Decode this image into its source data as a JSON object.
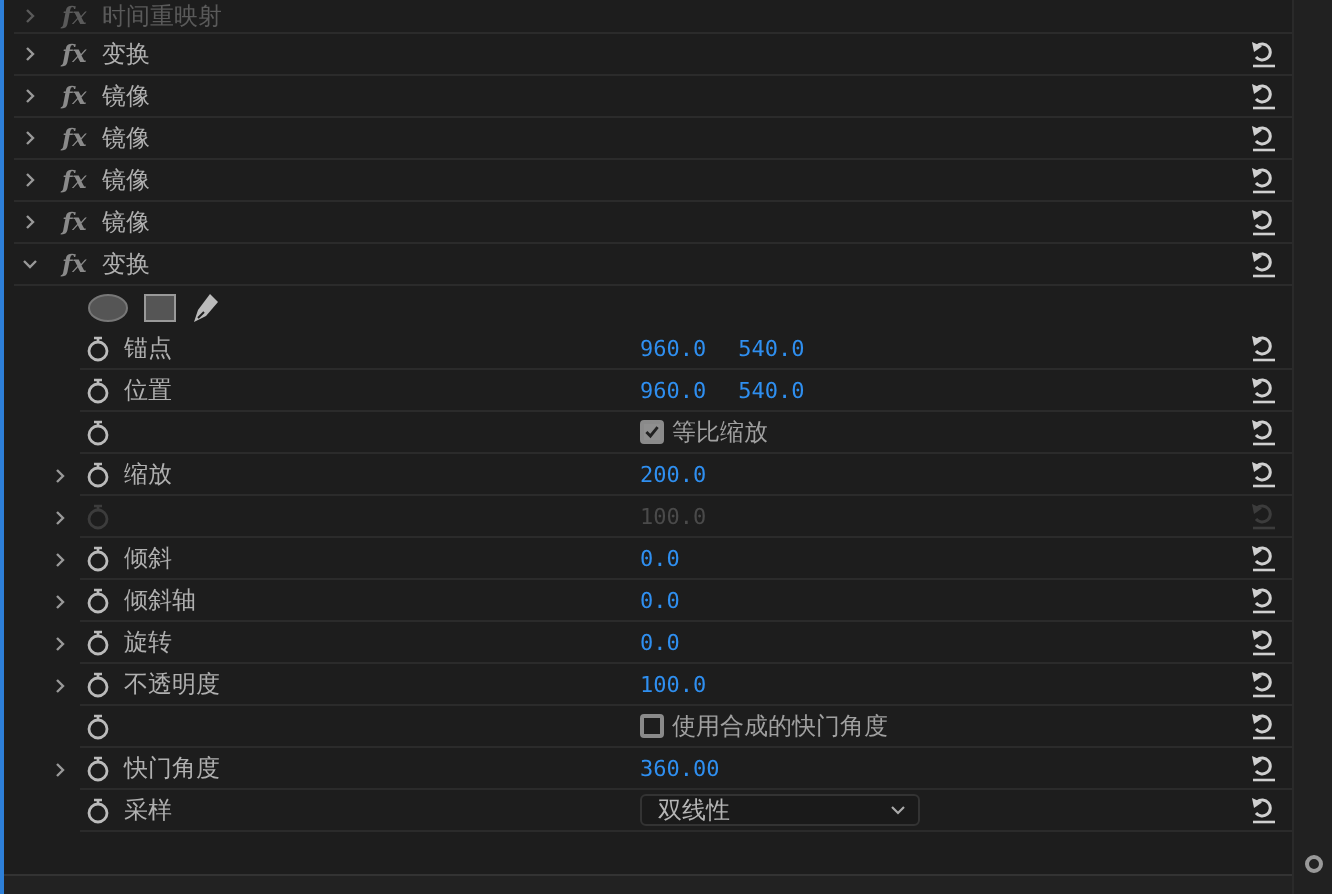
{
  "effects": [
    {
      "name": "时间重映射",
      "badge": "fx",
      "expanded": false,
      "disabled": true,
      "reset": false
    },
    {
      "name": "变换",
      "badge": "fx",
      "expanded": false,
      "disabled": false,
      "reset": true
    },
    {
      "name": "镜像",
      "badge": "fx",
      "expanded": false,
      "disabled": false,
      "reset": true
    },
    {
      "name": "镜像",
      "badge": "fx",
      "expanded": false,
      "disabled": false,
      "reset": true
    },
    {
      "name": "镜像",
      "badge": "fx",
      "expanded": false,
      "disabled": false,
      "reset": true
    },
    {
      "name": "镜像",
      "badge": "fx",
      "expanded": false,
      "disabled": false,
      "reset": true
    },
    {
      "name": "变换",
      "badge": "fx",
      "expanded": true,
      "disabled": false,
      "reset": true,
      "properties": [
        {
          "kind": "tools"
        },
        {
          "kind": "values",
          "label": "锚点",
          "expandable": false,
          "disabled": false,
          "values": [
            "960.0",
            "540.0"
          ]
        },
        {
          "kind": "values",
          "label": "位置",
          "expandable": false,
          "disabled": false,
          "values": [
            "960.0",
            "540.0"
          ]
        },
        {
          "kind": "checkbox",
          "expandable": false,
          "disabled": false,
          "checked": true,
          "text": "等比缩放"
        },
        {
          "kind": "values",
          "label": "缩放",
          "expandable": true,
          "disabled": false,
          "values": [
            "200.0"
          ]
        },
        {
          "kind": "values",
          "expandable": true,
          "disabled": true,
          "values": [
            "100.0"
          ]
        },
        {
          "kind": "values",
          "label": "倾斜",
          "expandable": true,
          "disabled": false,
          "values": [
            "0.0"
          ]
        },
        {
          "kind": "values",
          "label": "倾斜轴",
          "expandable": true,
          "disabled": false,
          "values": [
            "0.0"
          ]
        },
        {
          "kind": "values",
          "label": "旋转",
          "expandable": true,
          "disabled": false,
          "values": [
            "0.0"
          ]
        },
        {
          "kind": "values",
          "label": "不透明度",
          "expandable": true,
          "disabled": false,
          "values": [
            "100.0"
          ]
        },
        {
          "kind": "checkbox",
          "expandable": false,
          "disabled": false,
          "checked": false,
          "text": "使用合成的快门角度"
        },
        {
          "kind": "values",
          "label": "快门角度",
          "expandable": true,
          "disabled": false,
          "values": [
            "360.00"
          ]
        },
        {
          "kind": "dropdown",
          "label": "采样",
          "expandable": false,
          "disabled": false,
          "value": "双线性"
        }
      ]
    }
  ]
}
